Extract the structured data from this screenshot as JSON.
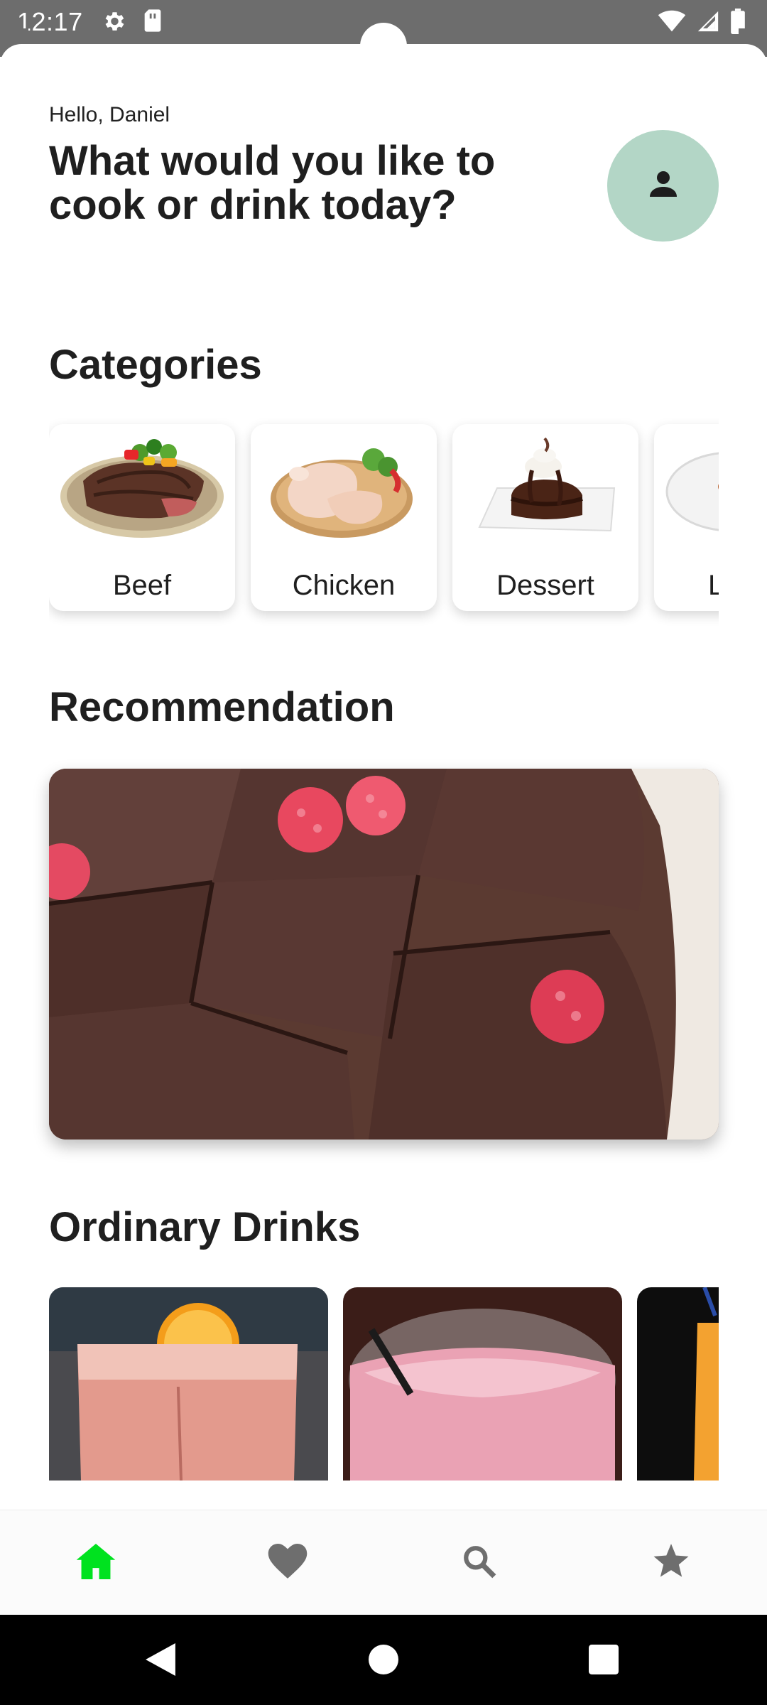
{
  "status_bar": {
    "time": "12:17",
    "left_icons": [
      "settings-icon",
      "sim-card-icon"
    ],
    "right_icons": [
      "wifi-icon",
      "signal-icon",
      "battery-icon"
    ],
    "bg_color": "#6d6d6d"
  },
  "header": {
    "greeting": "Hello, Daniel",
    "headline": "What would you like to cook or drink today?",
    "avatar_icon": "person-icon",
    "avatar_color": "#b3d6c6"
  },
  "categories": {
    "title": "Categories",
    "items": [
      {
        "label": "Beef"
      },
      {
        "label": "Chicken"
      },
      {
        "label": "Dessert"
      },
      {
        "label": "L"
      }
    ]
  },
  "recommendation": {
    "title": "Recommendation"
  },
  "drinks": {
    "title": "Ordinary Drinks",
    "items": 3
  },
  "bottom_nav": {
    "items": [
      {
        "icon": "home-icon",
        "active": true
      },
      {
        "icon": "heart-icon",
        "active": false
      },
      {
        "icon": "search-icon",
        "active": false
      },
      {
        "icon": "star-icon",
        "active": false
      }
    ],
    "active_color": "#00e21f",
    "inactive_color": "#6e6e6e"
  },
  "system_nav": {
    "buttons": [
      "back-icon",
      "home-circle-icon",
      "recents-icon"
    ]
  }
}
